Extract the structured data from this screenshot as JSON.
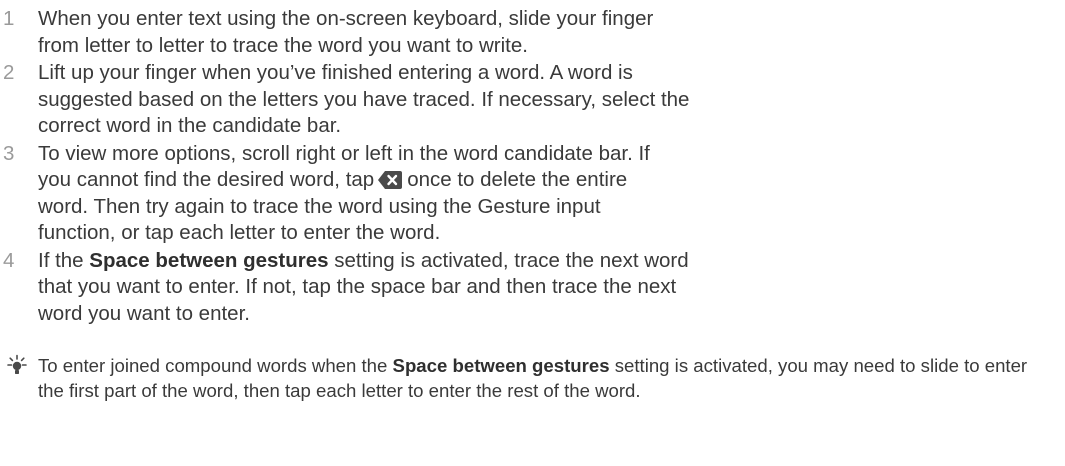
{
  "steps": [
    {
      "num": "1",
      "text": "When you enter text using the on-screen keyboard, slide your finger from letter to letter to trace the word you want to write."
    },
    {
      "num": "2",
      "text": "Lift up your finger when you’ve finished entering a word. A word is suggested based on the letters you have traced. If necessary, select the correct word in the candidate bar."
    },
    {
      "num": "3",
      "text_before": "To view more options, scroll right or left in the word candidate bar. If you cannot find the desired word, tap",
      "icon": "delete-backspace-icon",
      "text_after": "once to delete the entire word. Then try again to trace the word using the Gesture input function, or tap each letter to enter the word."
    },
    {
      "num": "4",
      "text_before": "If the",
      "bold": "Space between gestures",
      "text_after": "setting is activated, trace the next word that you want to enter. If not, tap the space bar and then trace the next word you want to enter."
    }
  ],
  "tip": {
    "icon": "lightbulb-tip-icon",
    "text_before": "To enter joined compound words when the",
    "bold": "Space between gestures",
    "text_after": "setting is activated, you may need to slide to enter the first part of the word, then tap each letter to enter the rest of the word."
  },
  "colors": {
    "text": "#3a3a3a",
    "number": "#9a9a9a",
    "icon": "#4a4a4a"
  }
}
